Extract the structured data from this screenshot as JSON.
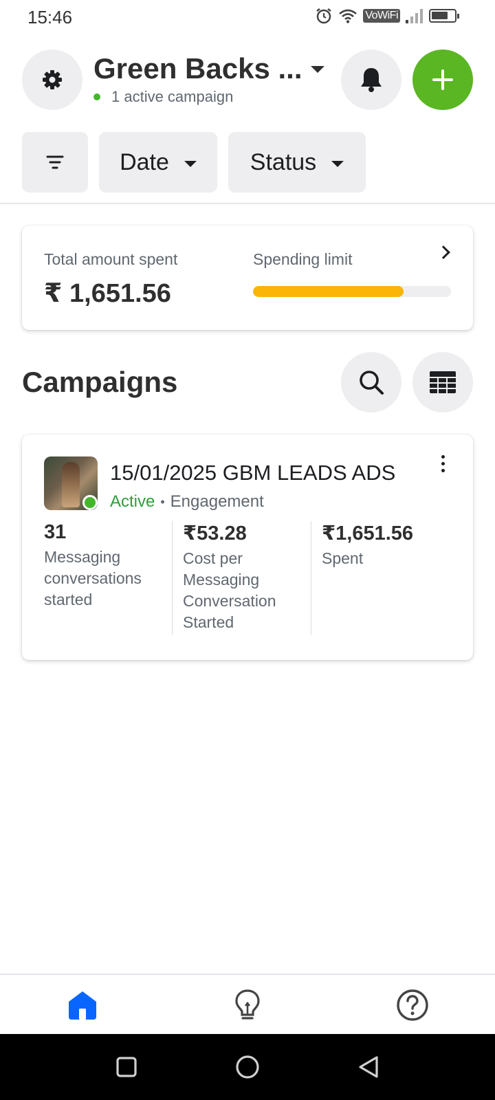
{
  "status_bar": {
    "time": "15:46",
    "network_badge": "VoWiFi",
    "battery_level": 0.75,
    "icons": [
      "alarm-icon",
      "wifi-icon",
      "signal-icon",
      "battery-icon"
    ]
  },
  "header": {
    "account_name": "Green Backs ...",
    "active_campaigns": "1 active campaign",
    "icons": {
      "settings": "gear-icon",
      "notifications": "bell-icon",
      "add": "plus-icon"
    }
  },
  "filters": {
    "items": [
      {
        "label": "",
        "icon": "filter-icon"
      },
      {
        "label": "Date"
      },
      {
        "label": "Status"
      }
    ]
  },
  "spend_summary": {
    "total_label": "Total amount spent",
    "total_value": "₹ 1,651.56",
    "limit_label": "Spending limit",
    "limit_progress": 0.76,
    "limit_color": "#fbb507"
  },
  "campaigns": {
    "title": "Campaigns",
    "icons": {
      "search": "search-icon",
      "columns": "table-icon"
    },
    "items": [
      {
        "name": "15/01/2025 GBM LEADS ADS",
        "status": "Active",
        "separator": "•",
        "objective": "Engagement",
        "metrics": [
          {
            "value": "31",
            "label": "Messaging conversations started"
          },
          {
            "value": "₹53.28",
            "label": "Cost per Messaging Conversation Started"
          },
          {
            "value": "₹1,651.56",
            "label": "Spent"
          }
        ]
      }
    ]
  },
  "bottom_nav": {
    "items": [
      {
        "icon": "home-icon",
        "active": true
      },
      {
        "icon": "lightbulb-icon",
        "active": false
      },
      {
        "icon": "help-icon",
        "active": false
      }
    ],
    "accent_color": "#0866ff"
  },
  "system_nav": {
    "icons": [
      "recents-icon",
      "home-circle-icon",
      "back-icon"
    ]
  }
}
